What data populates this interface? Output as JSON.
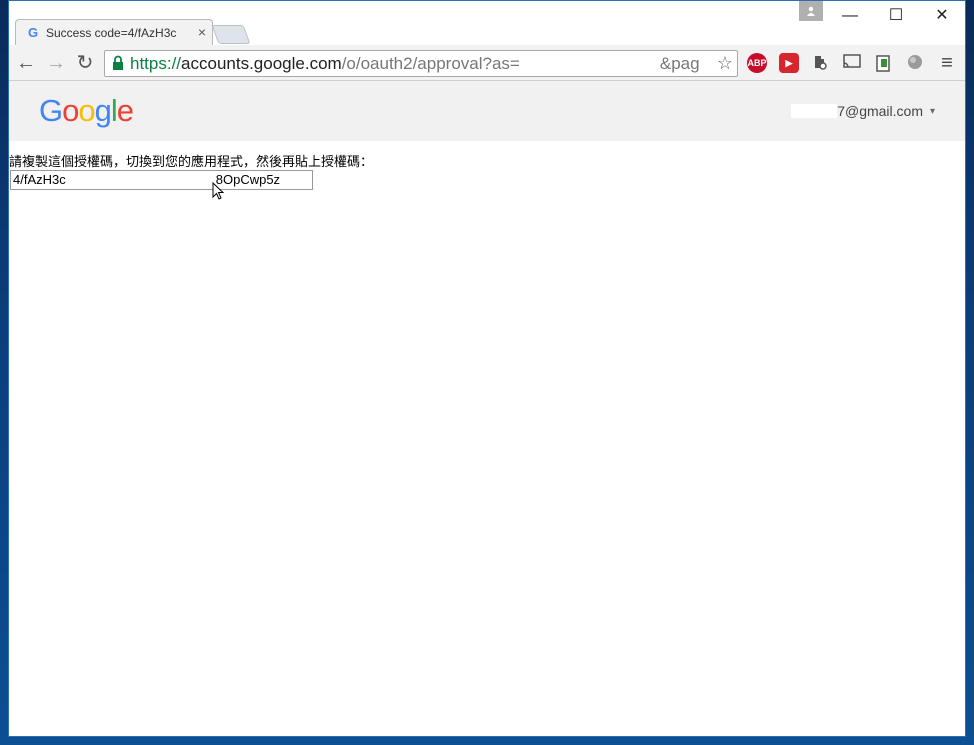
{
  "tab": {
    "title": "Success code=4/fAzH3c",
    "close_symbol": "×"
  },
  "window_controls": {
    "minimize": "—",
    "maximize": "☐",
    "close": "✕"
  },
  "nav": {
    "back": "←",
    "forward": "→",
    "reload": "↻"
  },
  "omnibox": {
    "scheme": "https://",
    "host": "accounts.google.com",
    "path": "/o/oauth2/approval?as=",
    "path_tail": "&pag",
    "star": "☆"
  },
  "extensions": [
    {
      "name": "adblock-plus-icon",
      "label": "ABP",
      "color": "#c70d2c"
    },
    {
      "name": "play-extension-icon",
      "label": "▶",
      "color": "#d7262d"
    },
    {
      "name": "extension-icon",
      "label": "",
      "color": "#555555"
    },
    {
      "name": "cast-icon",
      "label": "",
      "color": "#555555"
    },
    {
      "name": "clipboard-icon",
      "label": "",
      "color": "#3a8f3a"
    },
    {
      "name": "globe-icon",
      "label": "",
      "color": "#8a8a8a"
    }
  ],
  "menu": "≡",
  "google_logo": {
    "letters": [
      "G",
      "o",
      "o",
      "g",
      "l",
      "e"
    ],
    "colors": [
      "#4285F4",
      "#EA4335",
      "#FBBC05",
      "#4285F4",
      "#34A853",
      "#EA4335"
    ]
  },
  "account": {
    "email_visible": "7@gmail.com",
    "caret": "▾"
  },
  "page": {
    "instruction": "請複製這個授權碼，切換到您的應用程式，然後再貼上授權碼：",
    "code_start": "4/fAzH3c",
    "code_end": "8OpCwp5z"
  }
}
